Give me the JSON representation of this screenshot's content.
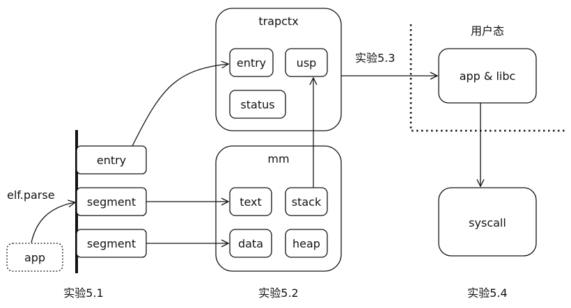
{
  "containers": {
    "trapctx": "trapctx",
    "mm": "mm",
    "user_mode": "用户态"
  },
  "nodes": {
    "trap_entry": "entry",
    "trap_usp": "usp",
    "trap_status": "status",
    "mm_text": "text",
    "mm_stack": "stack",
    "mm_data": "data",
    "mm_heap": "heap",
    "elf_entry": "entry",
    "elf_segment_1": "segment",
    "elf_segment_2": "segment",
    "app": "app",
    "app_libc": "app & libc",
    "syscall": "syscall"
  },
  "edge_labels": {
    "elf_parse": "elf.parse",
    "lab_5_3": "实验5.3"
  },
  "footer": {
    "lab_5_1": "实验5.1",
    "lab_5_2": "实验5.2",
    "lab_5_4": "实验5.4"
  },
  "colors": {
    "stroke": "#111111",
    "background": "#ffffff"
  }
}
